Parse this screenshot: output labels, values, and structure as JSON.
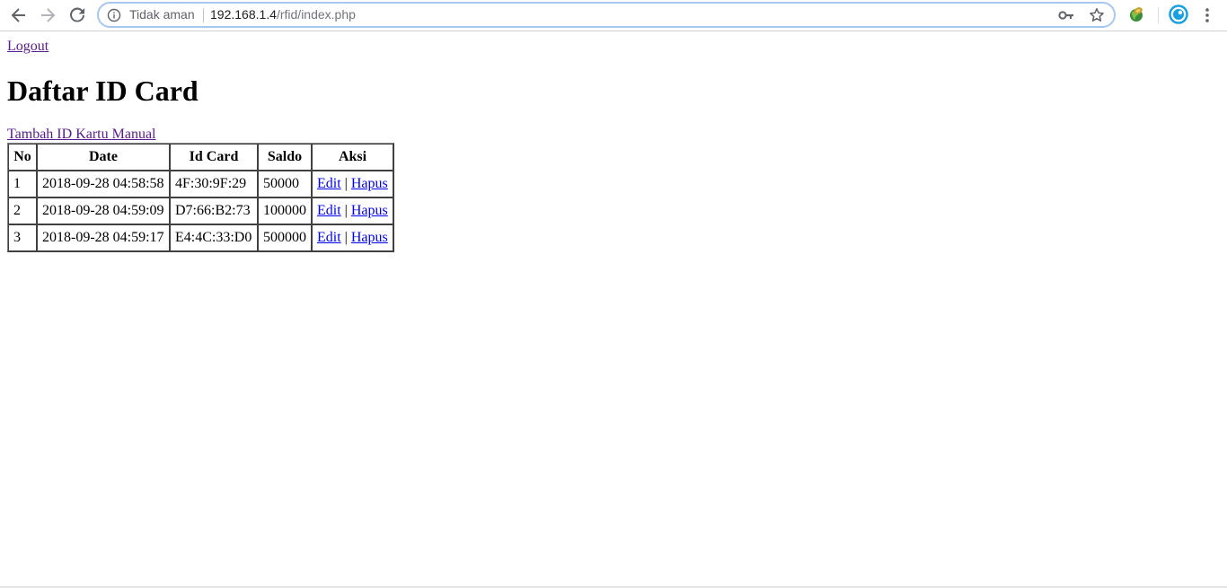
{
  "browser": {
    "security_label": "Tidak aman",
    "url_host": "192.168.1.4",
    "url_path": "/rfid/index.php"
  },
  "page": {
    "logout_label": "Logout",
    "title": "Daftar ID Card",
    "add_link_label": "Tambah ID Kartu Manual"
  },
  "table": {
    "headers": [
      "No",
      "Date",
      "Id Card",
      "Saldo",
      "Aksi"
    ],
    "rows": [
      {
        "no": "1",
        "date": "2018-09-28 04:58:58",
        "id_card": "4F:30:9F:29",
        "saldo": "50000",
        "edit": "Edit",
        "sep": "|",
        "delete": "Hapus"
      },
      {
        "no": "2",
        "date": "2018-09-28 04:59:09",
        "id_card": "D7:66:B2:73",
        "saldo": "100000",
        "edit": "Edit",
        "sep": "|",
        "delete": "Hapus"
      },
      {
        "no": "3",
        "date": "2018-09-28 04:59:17",
        "id_card": "E4:4C:33:D0",
        "saldo": "500000",
        "edit": "Edit",
        "sep": "|",
        "delete": "Hapus"
      }
    ]
  },
  "icons": {
    "back": "arrow-left-icon",
    "forward": "arrow-right-icon",
    "reload": "reload-icon",
    "info": "info-icon",
    "key": "key-icon",
    "star": "star-icon",
    "extension_globe": "globe-extension-icon",
    "extension_circle": "circle-extension-icon",
    "menu": "kebab-menu-icon"
  },
  "colors": {
    "link": "#0000ee",
    "visited_link": "#551a8b",
    "omnibox_border": "#a8c7f0",
    "extension_blue": "#1a9fe0"
  }
}
